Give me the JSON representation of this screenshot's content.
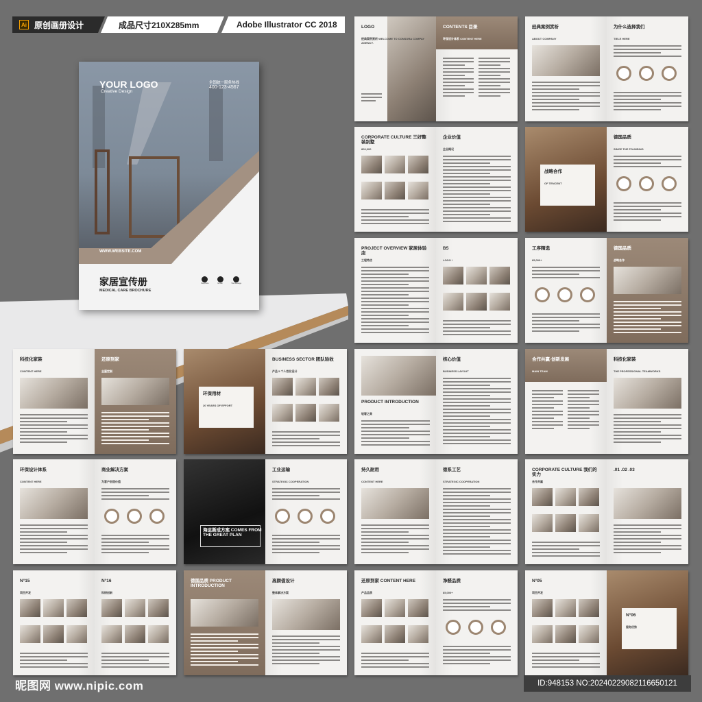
{
  "header": {
    "badge_icon": "Ai",
    "label": "原创画册设计",
    "size": "成品尺寸210X285mm",
    "software": "Adobe Illustrator CC 2018"
  },
  "cover": {
    "logo": "YOUR LOGO",
    "tagline": "Creative Design",
    "hotline_label": "全国统一服务热线",
    "hotline": "400-123-4567",
    "website": "WWW.WEBSITE.COM",
    "title": "家居宣传册",
    "subtitle": "MEDICAL CARE BROCHURE",
    "contact_labels": [
      "Telephone",
      "E-mail",
      "We Message"
    ]
  },
  "spreads": [
    {
      "left": {
        "title": "LOGO",
        "sub": "经典案例赏析 WELCOME TO CONSORA COMPAY AGENCY."
      },
      "right": {
        "title": "CONTENTS 目录",
        "sub": "环保设计体系 CONTENT HERE"
      }
    },
    {
      "left": {
        "title": "经典案例赏析",
        "sub": "ABOUT COMPANY"
      },
      "right": {
        "title": "为什么选择我们",
        "sub": "TIELE HERE"
      }
    },
    {
      "left": {
        "title": "CORPORATE CULTURE 三好整装别墅",
        "sub": "800,000"
      },
      "right": {
        "title": "企业价值",
        "sub": "企业概况"
      }
    },
    {
      "left": {
        "title": "战略合作",
        "sub": "OF TENCENT"
      },
      "right": {
        "title": "德国品质",
        "sub": "SINCE THE FOUNDING"
      }
    },
    {
      "left": {
        "title": "PROJECT OVERVIEW 家居体验店",
        "sub": "工程特点"
      },
      "right": {
        "title": "B5",
        "sub": "LOGO /"
      }
    },
    {
      "left": {
        "title": "工序精选",
        "sub": "85,000+"
      },
      "right": {
        "title": "德国品质",
        "sub": "战略合作"
      }
    },
    {
      "left": {
        "title": "科技化家装",
        "sub": "CONTENT HERE"
      },
      "right": {
        "title": "还原到家",
        "sub": "全屋定制"
      }
    },
    {
      "left": {
        "title": "环保用材",
        "sub": "20 YEARS OF EFFORT"
      },
      "right": {
        "title": "BUSINESS SECTOR 团队验收",
        "sub": "产品 5 个人性化设计"
      }
    },
    {
      "left": {
        "title": "PRODUCT INTRODUCTION",
        "sub": "轻奢之美"
      },
      "right": {
        "title": "核心价值",
        "sub": "BUSINESS LAYOUT"
      }
    },
    {
      "left": {
        "title": "合作共赢·创新发展",
        "sub": "MAIN TEAM"
      },
      "right": {
        "title": "科技化家装",
        "sub": "THE PROFESSIONAL TEAMWORKS"
      }
    },
    {
      "left": {
        "title": "环保设计体系",
        "sub": "CONTENT HERE"
      },
      "right": {
        "title": "商业解决方案",
        "sub": "为客户创造价值"
      }
    },
    {
      "left": {
        "title": "海运撕成方案 COMES FROM THE GREAT PLAN",
        "sub": ""
      },
      "right": {
        "title": "工业运输",
        "sub": "STRATEGIC COOPERATION"
      }
    },
    {
      "left": {
        "title": "持久耐用",
        "sub": "CONTENT HERE"
      },
      "right": {
        "title": "德系工艺",
        "sub": "STRATEGIC COOPERATION"
      }
    },
    {
      "left": {
        "title": "CORPORATE CULTURE 我们的实力",
        "sub": "合作共赢"
      },
      "right": {
        "title": ".01 .02 .03",
        "sub": ""
      }
    },
    {
      "left": {
        "title": "N°15",
        "sub": "项目开发"
      },
      "right": {
        "title": "N°16",
        "sub": "科研创新"
      }
    },
    {
      "left": {
        "title": "德国品质 PRODUCT INTRODUCTION",
        "sub": ""
      },
      "right": {
        "title": "高颜值设计",
        "sub": "整体解决方案"
      }
    },
    {
      "left": {
        "title": "还原到家 CONTENT HERE",
        "sub": "产品品质"
      },
      "right": {
        "title": "净醛品质",
        "sub": "85,000+"
      }
    },
    {
      "left": {
        "title": "N°05",
        "sub": "项目开发"
      },
      "right": {
        "title": "N°06",
        "sub": "服务优势"
      }
    }
  ],
  "footer": {
    "watermark": "昵图网 www.nipic.com",
    "id": "ID:948153 NO:20240229082116650121"
  }
}
